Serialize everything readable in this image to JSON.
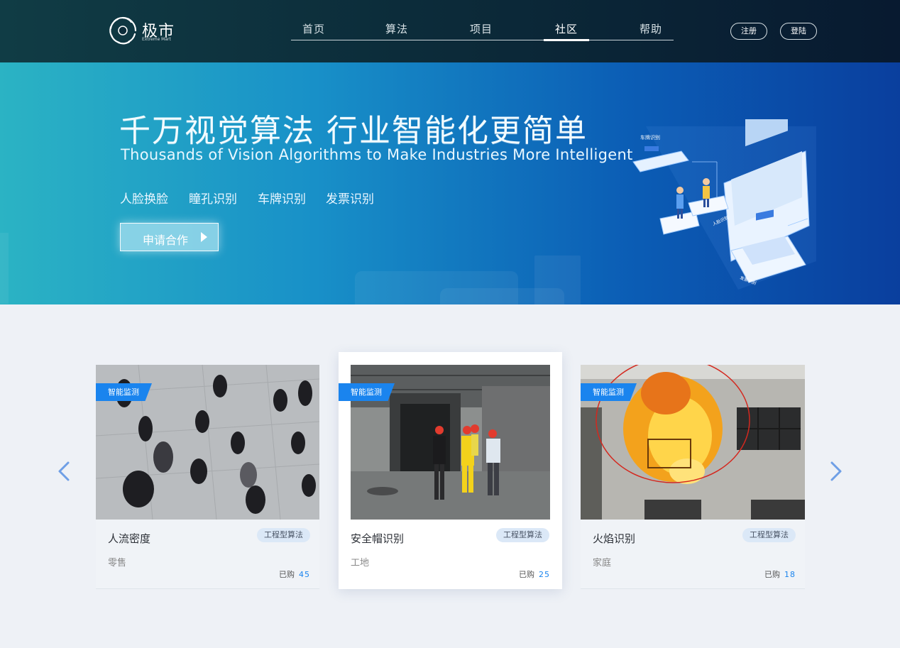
{
  "brand": {
    "name_cn": "极市",
    "name_en": "Extreme Mart"
  },
  "nav": {
    "items": [
      {
        "label": "首页"
      },
      {
        "label": "算法"
      },
      {
        "label": "项目"
      },
      {
        "label": "社区"
      },
      {
        "label": "帮助"
      }
    ],
    "active": "社区"
  },
  "auth": {
    "register_label": "注册",
    "login_label": "登陆"
  },
  "banner": {
    "title": "千万视觉算法  行业智能化更简单",
    "subtitle": "Thousands of Vision Algorithms to Make Industries More Intelligent",
    "tags": [
      "人脸换脸",
      "瞳孔识别",
      "车牌识别",
      "发票识别"
    ],
    "cta_label": "申请合作",
    "illustration_labels": [
      "车牌识别",
      "人脸识别",
      "发票识别"
    ]
  },
  "cards": [
    {
      "badge": "智能监测",
      "name": "人流密度",
      "type": "工程型算法",
      "scene": "零售",
      "sold_label": "已购",
      "sold": "45"
    },
    {
      "badge": "智能监测",
      "name": "安全帽识别",
      "type": "工程型算法",
      "scene": "工地",
      "sold_label": "已购",
      "sold": "25"
    },
    {
      "badge": "智能监测",
      "name": "火焰识别",
      "type": "工程型算法",
      "scene": "家庭",
      "sold_label": "已购",
      "sold": "18"
    }
  ],
  "colors": {
    "accent": "#1a84ee",
    "header": "#0c2c3a",
    "banner_start": "#2bb3c4",
    "banner_end": "#0a3f9e"
  },
  "icons": {
    "prev": "chevron-left-icon",
    "next": "chevron-right-icon",
    "cta": "play-arrow-icon"
  }
}
